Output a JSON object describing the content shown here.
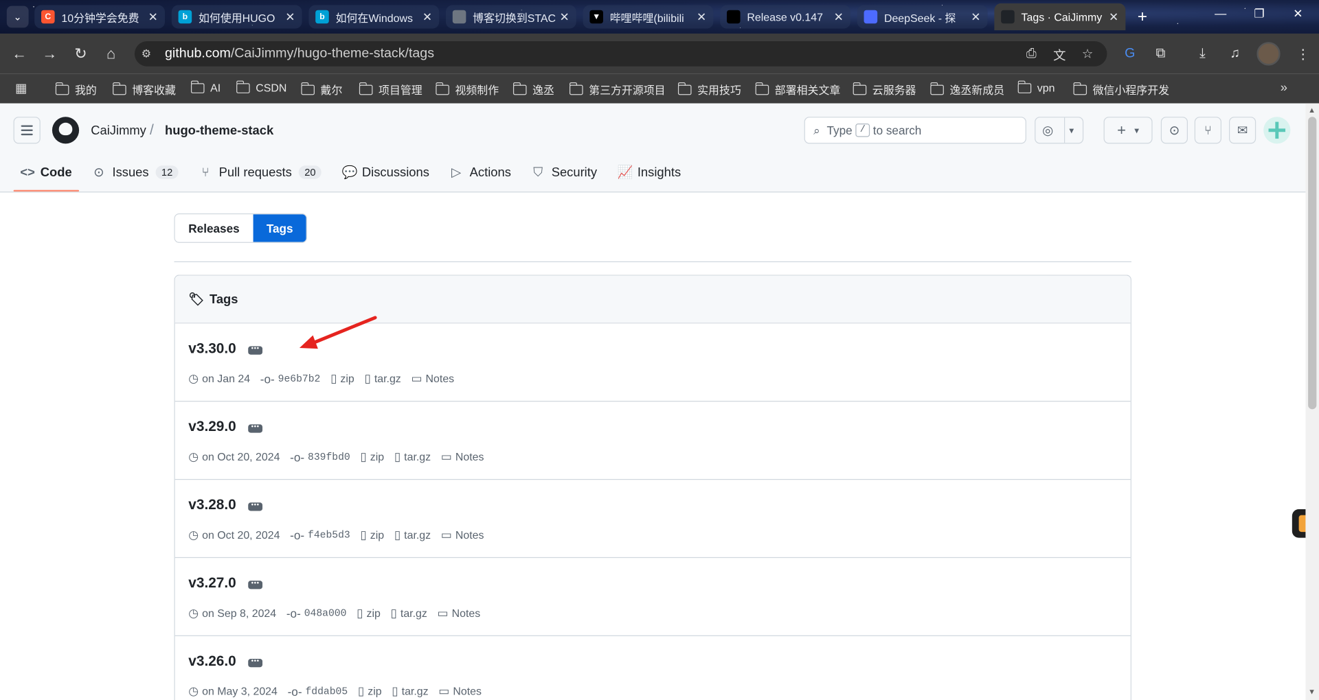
{
  "browser": {
    "tabs": [
      {
        "title": "10分钟学会免费",
        "favicon_color": "#fc5531",
        "favicon_char": "C"
      },
      {
        "title": "如何使用HUGO",
        "favicon_color": "#00a1d6",
        "favicon_char": "b"
      },
      {
        "title": "如何在Windows",
        "favicon_color": "#00a1d6",
        "favicon_char": "b"
      },
      {
        "title": "博客切换到STAC",
        "favicon_color": "#6e7681",
        "favicon_char": ""
      },
      {
        "title": "哔哩哔哩(bilibili",
        "favicon_color": "#000000",
        "favicon_char": "▼"
      },
      {
        "title": "Release v0.147",
        "favicon_color": "#000000",
        "favicon_char": ""
      },
      {
        "title": "DeepSeek - 探",
        "favicon_color": "#4d6bfe",
        "favicon_char": ""
      },
      {
        "title": "Tags · CaiJimmy",
        "favicon_color": "#1f2328",
        "favicon_char": ""
      }
    ],
    "url_domain": "github.com",
    "url_path": "/CaiJimmy/hugo-theme-stack/tags",
    "bookmarks": [
      "我的",
      "博客收藏",
      "AI",
      "CSDN",
      "戴尔",
      "项目管理",
      "视频制作",
      "逸丞",
      "第三方开源项目",
      "实用技巧",
      "部署相关文章",
      "云服务器",
      "逸丞新成员",
      "vpn",
      "微信小程序开发"
    ]
  },
  "header": {
    "owner": "CaiJimmy",
    "separator": "/",
    "repo": "hugo-theme-stack",
    "search_prefix": "Type",
    "search_key": "/",
    "search_suffix": "to search"
  },
  "repo_nav": [
    {
      "label": "Code",
      "icon": "code-icon",
      "glyph": "<>",
      "count": ""
    },
    {
      "label": "Issues",
      "icon": "issue-icon",
      "glyph": "⊙",
      "count": "12"
    },
    {
      "label": "Pull requests",
      "icon": "pull-request-icon",
      "glyph": "⑂",
      "count": "20"
    },
    {
      "label": "Discussions",
      "icon": "discussion-icon",
      "glyph": "💬",
      "count": ""
    },
    {
      "label": "Actions",
      "icon": "play-icon",
      "glyph": "▷",
      "count": ""
    },
    {
      "label": "Security",
      "icon": "shield-icon",
      "glyph": "⛉",
      "count": ""
    },
    {
      "label": "Insights",
      "icon": "graph-icon",
      "glyph": "📈",
      "count": ""
    }
  ],
  "toggle": {
    "releases": "Releases",
    "tags": "Tags"
  },
  "tags_box": {
    "title": "Tags",
    "zip_label": "zip",
    "targz_label": "tar.gz",
    "notes_label": "Notes",
    "items": [
      {
        "name": "v3.30.0",
        "date": "on Jan 24",
        "sha": "9e6b7b2"
      },
      {
        "name": "v3.29.0",
        "date": "on Oct 20, 2024",
        "sha": "839fbd0"
      },
      {
        "name": "v3.28.0",
        "date": "on Oct 20, 2024",
        "sha": "f4eb5d3"
      },
      {
        "name": "v3.27.0",
        "date": "on Sep 8, 2024",
        "sha": "048a000"
      },
      {
        "name": "v3.26.0",
        "date": "on May 3, 2024",
        "sha": "fddab05"
      }
    ]
  },
  "colors": {
    "accent": "#0969da",
    "nav_underline": "#fd8c73",
    "arrow": "#e5241f"
  }
}
